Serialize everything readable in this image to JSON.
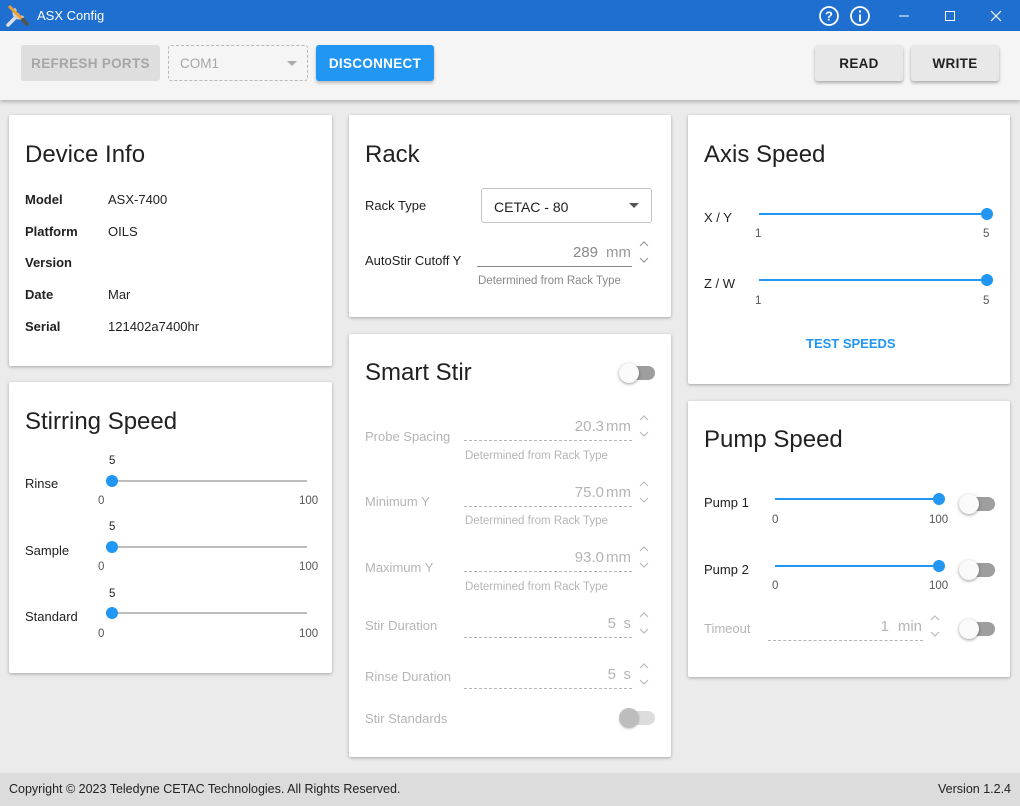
{
  "window": {
    "title": "ASX Config",
    "icons": [
      "tools-icon",
      "help-icon",
      "info-icon",
      "minimize-icon",
      "maximize-icon",
      "close-icon"
    ],
    "accent": "#1e6fd0"
  },
  "toolbar": {
    "refresh_label": "REFRESH PORTS",
    "port_value": "COM1",
    "disconnect_label": "DISCONNECT",
    "read_label": "READ",
    "write_label": "WRITE",
    "primary_color": "#2196f3"
  },
  "device_info": {
    "title": "Device Info",
    "rows": [
      {
        "label": "Model",
        "value": "ASX-7400"
      },
      {
        "label": "Platform",
        "value": "OILS"
      },
      {
        "label": "Version",
        "value": ""
      },
      {
        "label": "Date",
        "value": "Mar"
      },
      {
        "label": "Serial",
        "value": "121402a7400hr"
      }
    ]
  },
  "stirring_speed": {
    "title": "Stirring Speed",
    "sliders": [
      {
        "label": "Rinse",
        "value": "5",
        "min": "0",
        "max": "100"
      },
      {
        "label": "Sample",
        "value": "5",
        "min": "0",
        "max": "100"
      },
      {
        "label": "Standard",
        "value": "5",
        "min": "0",
        "max": "100"
      }
    ]
  },
  "rack": {
    "title": "Rack",
    "rack_type_label": "Rack Type",
    "rack_type_value": "CETAC - 80",
    "autostir_label": "AutoStir Cutoff Y",
    "autostir_value": "289",
    "autostir_unit": "mm",
    "autostir_hint": "Determined from Rack Type"
  },
  "smart_stir": {
    "title": "Smart Stir",
    "enabled": false,
    "fields": [
      {
        "label": "Probe Spacing",
        "value": "20.3",
        "unit": "mm",
        "hint": "Determined from Rack Type"
      },
      {
        "label": "Minimum Y",
        "value": "75.0",
        "unit": "mm",
        "hint": "Determined from Rack Type"
      },
      {
        "label": "Maximum Y",
        "value": "93.0",
        "unit": "mm",
        "hint": "Determined from Rack Type"
      },
      {
        "label": "Stir Duration",
        "value": "5",
        "unit": "s",
        "hint": ""
      },
      {
        "label": "Rinse Duration",
        "value": "5",
        "unit": "s",
        "hint": ""
      }
    ],
    "stir_standards_label": "Stir Standards",
    "stir_standards_enabled": false
  },
  "axis_speed": {
    "title": "Axis Speed",
    "sliders": [
      {
        "label": "X / Y",
        "value": 5,
        "min": "1",
        "max": "5"
      },
      {
        "label": "Z / W",
        "value": 5,
        "min": "1",
        "max": "5"
      }
    ],
    "test_label": "TEST SPEEDS"
  },
  "pump_speed": {
    "title": "Pump Speed",
    "sliders": [
      {
        "label": "Pump 1",
        "value": 100,
        "min": "0",
        "max": "100",
        "enabled": false
      },
      {
        "label": "Pump 2",
        "value": 100,
        "min": "0",
        "max": "100",
        "enabled": false
      }
    ],
    "timeout_label": "Timeout",
    "timeout_value": "1",
    "timeout_unit": "min",
    "timeout_enabled": false
  },
  "footer": {
    "copyright": "Copyright © 2023 Teledyne CETAC Technologies. All Rights Reserved.",
    "version": "Version 1.2.4"
  }
}
